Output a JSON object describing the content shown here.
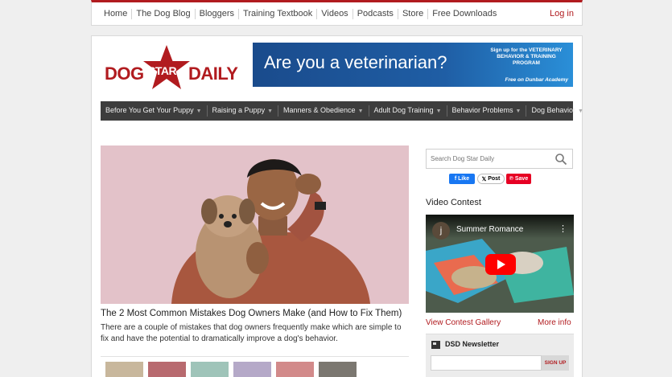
{
  "top_nav": {
    "links": [
      "Home",
      "The Dog Blog",
      "Bloggers",
      "Training Textbook",
      "Videos",
      "Podcasts",
      "Store",
      "Free Downloads"
    ],
    "login": "Log in"
  },
  "logo": {
    "word_left": "DOG",
    "word_star": "STAR",
    "word_right": "DAILY"
  },
  "banner": {
    "headline": "Are you a veterinarian?",
    "signup_text": "Sign up for the VETERINARY BEHAVIOR & TRAINING PROGRAM",
    "free_text": "Free on Dunbar Academy"
  },
  "category_nav": [
    "Before You Get Your Puppy",
    "Raising a Puppy",
    "Manners & Obedience",
    "Adult Dog Training",
    "Behavior Problems",
    "Dog Behavior"
  ],
  "featured": {
    "title": "The 2 Most Common Mistakes Dog Owners Make (and How to Fix Them)",
    "description": "There are a couple of mistakes that dog owners frequently make which are simple to fix and have the potential to dramatically improve a dog's behavior."
  },
  "sidebar": {
    "search_placeholder": "Search Dog Star Daily",
    "social": {
      "facebook": "Like",
      "x": "Post",
      "pinterest": "Save"
    },
    "video_contest": {
      "heading": "Video Contest",
      "channel_initial": "j",
      "video_title": "Summer Romance",
      "gallery_link": "View Contest Gallery",
      "more_link": "More info"
    },
    "newsletter": {
      "title": "DSD Newsletter",
      "button": "SIGN UP"
    }
  },
  "colors": {
    "brand_red": "#b11b1f",
    "nav_dark": "#3d3d3d",
    "banner_blue": "#1f5ea5"
  }
}
